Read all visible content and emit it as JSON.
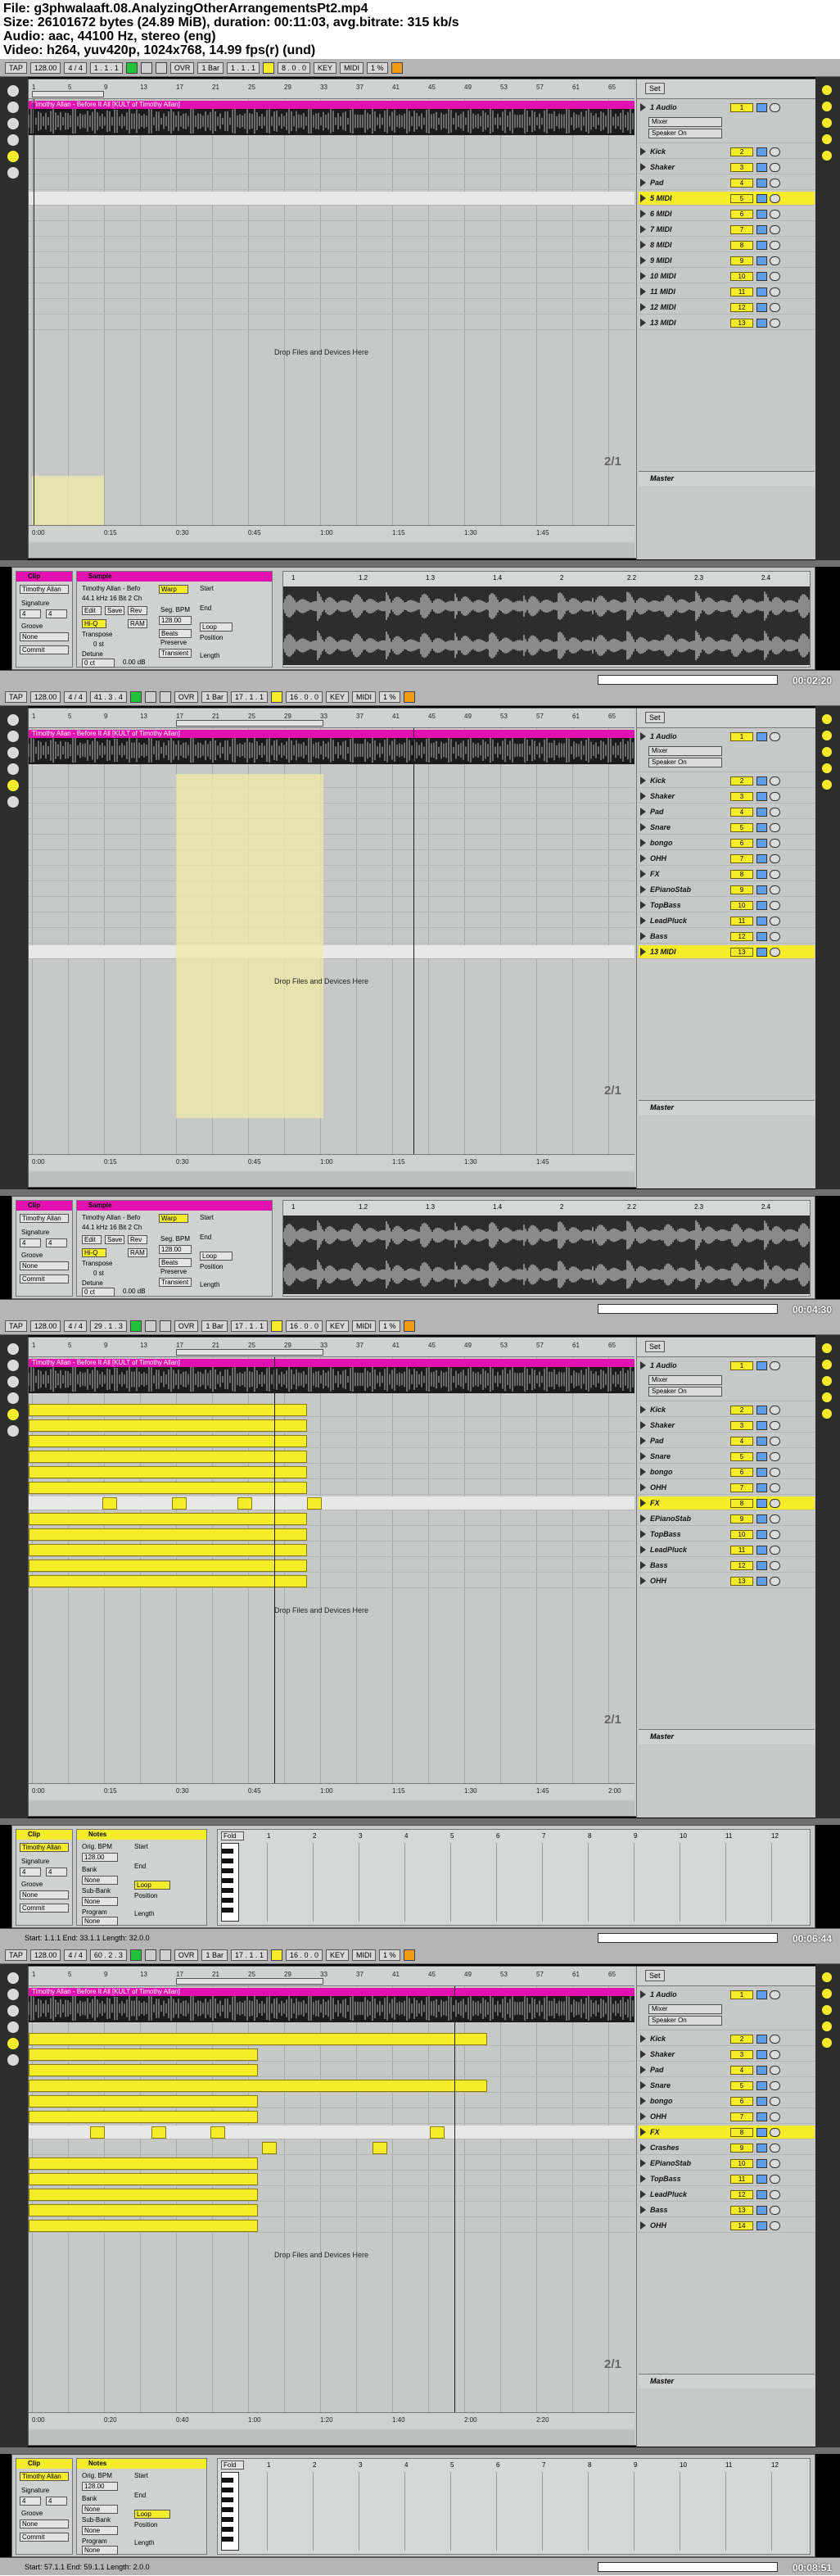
{
  "header": {
    "line1": "File: g3phwalaaft.08.AnalyzingOtherArrangementsPt2.mp4",
    "line2": "Size: 26101672 bytes (24.89 MiB), duration: 00:11:03, avg.bitrate: 315 kb/s",
    "line3": "Audio: aac, 44100 Hz, stereo (eng)",
    "line4": "Video: h264, yuv420p, 1024x768, 14.99 fps(r) (und)"
  },
  "common": {
    "tap": "TAP",
    "bpm": "128.00",
    "sig": "4 / 4",
    "ovr": "OVR",
    "quant": "1 Bar",
    "key": "KEY",
    "midi": "MIDI",
    "cpu": "1 %",
    "set": "Set",
    "audio_track": "1 Audio",
    "mixer_in": "Mixer",
    "speaker": "Speaker On",
    "master": "Master",
    "drop": "Drop Files and Devices Here",
    "clip_label": "Clip",
    "sample_label": "Sample",
    "notes_label": "Notes",
    "signature_label": "Signature",
    "groove_label": "Groove",
    "none": "None",
    "commit": "Commit",
    "warp": "Warp",
    "start": "Start",
    "end": "End",
    "loop": "Loop",
    "position": "Position",
    "length": "Length",
    "seg_bpm": "Seg. BPM",
    "transpose": "Transpose",
    "detune": "Detune",
    "beats": "Beats",
    "preserve": "Preserve",
    "trans_mode": "Transient",
    "orig_bpm": "Orig. BPM",
    "bank": "Bank",
    "subbank": "Sub-Bank",
    "program": "Program",
    "fold": "Fold",
    "hi_q": "Hi-Q",
    "ram": "RAM",
    "edit": "Edit",
    "save": "Save",
    "rev": "Rev",
    "clip_name": "Timothy Allan",
    "sample_name": "Timothy Allan - Befo",
    "sample_info": "44.1 kHz 16 Bit 2 Ch",
    "arr_clip_title": "Timothy Allan - Before It All [KULT of Timothy Allan]",
    "sig_num": "4",
    "sig_den": "4",
    "zero_st": "0 st",
    "zero_ct": "0 ct",
    "db": "0.00 dB",
    "ruler_ticks": [
      "1",
      "5",
      "9",
      "13",
      "17",
      "21",
      "25",
      "29",
      "33",
      "37",
      "41",
      "45",
      "49",
      "53",
      "57",
      "61",
      "65"
    ],
    "sample_ticks": [
      "1",
      "1.2",
      "1.3",
      "1.4",
      "2",
      "2.2",
      "2.3",
      "2.4"
    ],
    "midi_ticks": [
      "1",
      "2",
      "3",
      "4",
      "5",
      "6",
      "7",
      "8",
      "9",
      "10",
      "11",
      "12"
    ]
  },
  "frames": [
    {
      "position": "1 . 1 . 1",
      "loop_start": "1 . 1 . 1",
      "loop_len": "8 . 0 . 0",
      "page": "2/1",
      "timestamp": "00:02:20",
      "time_ticks": [
        "0:00",
        "0:15",
        "0:30",
        "0:45",
        "1:00",
        "1:15",
        "1:30",
        "1:45"
      ],
      "tracks": [
        {
          "name": "Kick",
          "num": "2"
        },
        {
          "name": "Shaker",
          "num": "3"
        },
        {
          "name": "Pad",
          "num": "4"
        },
        {
          "name": "5 MIDI",
          "num": "5",
          "sel": true
        },
        {
          "name": "6 MIDI",
          "num": "6"
        },
        {
          "name": "7 MIDI",
          "num": "7"
        },
        {
          "name": "8 MIDI",
          "num": "8"
        },
        {
          "name": "9 MIDI",
          "num": "9"
        },
        {
          "name": "10 MIDI",
          "num": "10"
        },
        {
          "name": "11 MIDI",
          "num": "11"
        },
        {
          "name": "12 MIDI",
          "num": "12"
        },
        {
          "name": "13 MIDI",
          "num": "13"
        }
      ]
    },
    {
      "position": "41 . 3 . 4",
      "loop_start": "17 . 1 . 1",
      "loop_len": "16 . 0 . 0",
      "page": "2/1",
      "timestamp": "00:04:30",
      "time_ticks": [
        "0:00",
        "0:15",
        "0:30",
        "0:45",
        "1:00",
        "1:15",
        "1:30",
        "1:45"
      ],
      "tracks": [
        {
          "name": "Kick",
          "num": "2"
        },
        {
          "name": "Shaker",
          "num": "3"
        },
        {
          "name": "Pad",
          "num": "4"
        },
        {
          "name": "Snare",
          "num": "5"
        },
        {
          "name": "bongo",
          "num": "6"
        },
        {
          "name": "OHH",
          "num": "7"
        },
        {
          "name": "FX",
          "num": "8"
        },
        {
          "name": "EPianoStab",
          "num": "9"
        },
        {
          "name": "TopBass",
          "num": "10"
        },
        {
          "name": "LeadPluck",
          "num": "11"
        },
        {
          "name": "Bass",
          "num": "12"
        },
        {
          "name": "13 MIDI",
          "num": "13",
          "sel": true
        }
      ]
    },
    {
      "position": "29 . 1 . 3",
      "loop_start": "17 . 1 . 1",
      "loop_len": "16 . 0 . 0",
      "page": "2/1",
      "timestamp": "00:06:44",
      "time_ticks": [
        "0:00",
        "0:15",
        "0:30",
        "0:45",
        "1:00",
        "1:15",
        "1:30",
        "1:45",
        "2:00"
      ],
      "status": "Start: 1.1.1  End: 33.1.1  Length: 32.0.0",
      "tracks": [
        {
          "name": "Kick",
          "num": "2"
        },
        {
          "name": "Shaker",
          "num": "3"
        },
        {
          "name": "Pad",
          "num": "4"
        },
        {
          "name": "Snare",
          "num": "5"
        },
        {
          "name": "bongo",
          "num": "6"
        },
        {
          "name": "OHH",
          "num": "7"
        },
        {
          "name": "FX",
          "num": "8",
          "sel": true
        },
        {
          "name": "EPianoStab",
          "num": "9"
        },
        {
          "name": "TopBass",
          "num": "10"
        },
        {
          "name": "LeadPluck",
          "num": "11"
        },
        {
          "name": "Bass",
          "num": "12"
        },
        {
          "name": "OHH",
          "num": "13"
        }
      ]
    },
    {
      "position": "60 . 2 . 3",
      "loop_start": "17 . 1 . 1",
      "loop_len": "16 . 0 . 0",
      "page": "2/1",
      "timestamp": "00:08:51",
      "time_ticks": [
        "0:00",
        "0:20",
        "0:40",
        "1:00",
        "1:20",
        "1:40",
        "2:00",
        "2:20"
      ],
      "status": "Start: 57.1.1  End: 59.1.1  Length: 2.0.0",
      "tracks": [
        {
          "name": "Kick",
          "num": "2"
        },
        {
          "name": "Shaker",
          "num": "3"
        },
        {
          "name": "Pad",
          "num": "4"
        },
        {
          "name": "Snare",
          "num": "5"
        },
        {
          "name": "bongo",
          "num": "6"
        },
        {
          "name": "OHH",
          "num": "7"
        },
        {
          "name": "FX",
          "num": "8",
          "sel": true
        },
        {
          "name": "Crashes",
          "num": "9"
        },
        {
          "name": "EPianoStab",
          "num": "10"
        },
        {
          "name": "TopBass",
          "num": "11"
        },
        {
          "name": "LeadPluck",
          "num": "12"
        },
        {
          "name": "Bass",
          "num": "13"
        },
        {
          "name": "OHH",
          "num": "14"
        }
      ]
    }
  ],
  "colors": {
    "clip_yellow": "#f6ed2a",
    "audio_magenta": "#e40faf",
    "panel_gray": "#c7c9c9",
    "dark": "#2d2d2d"
  }
}
